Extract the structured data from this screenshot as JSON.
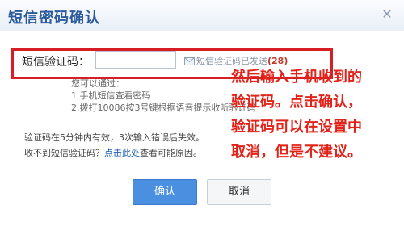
{
  "dialog": {
    "title": "短信密码确认",
    "close_glyph": "✕"
  },
  "form": {
    "code_label": "短信验证码：",
    "code_value": "",
    "sent_status": "短信验证码已发送",
    "sent_count": "(28)"
  },
  "hint": {
    "line1": "您可以通过：",
    "line2": "1.手机短信查看密码",
    "line3": "2.拨打10086按3号键根据语音提示收听验证码"
  },
  "info": {
    "validity_text": "验证码在5分钟内有效，3次输入错误后失效。",
    "no_code_prefix": "收不到短信验证码？",
    "no_code_link": "点击此处",
    "no_code_suffix": "查看可能原因。"
  },
  "annotation": {
    "lines": [
      "然后输入手机收到的",
      "验证码。点击确认，",
      "验证码可以在设置中",
      "取消，但是不建议。"
    ]
  },
  "buttons": {
    "confirm": "确认",
    "cancel": "取消"
  },
  "colors": {
    "title": "#2a5a9c",
    "highlight": "#d71e24",
    "annotation": "#e2231a",
    "link": "#1f5fb4",
    "primary_button": "#4a8fe0"
  },
  "icons": {
    "close": "close-icon",
    "envelope": "envelope-icon"
  }
}
